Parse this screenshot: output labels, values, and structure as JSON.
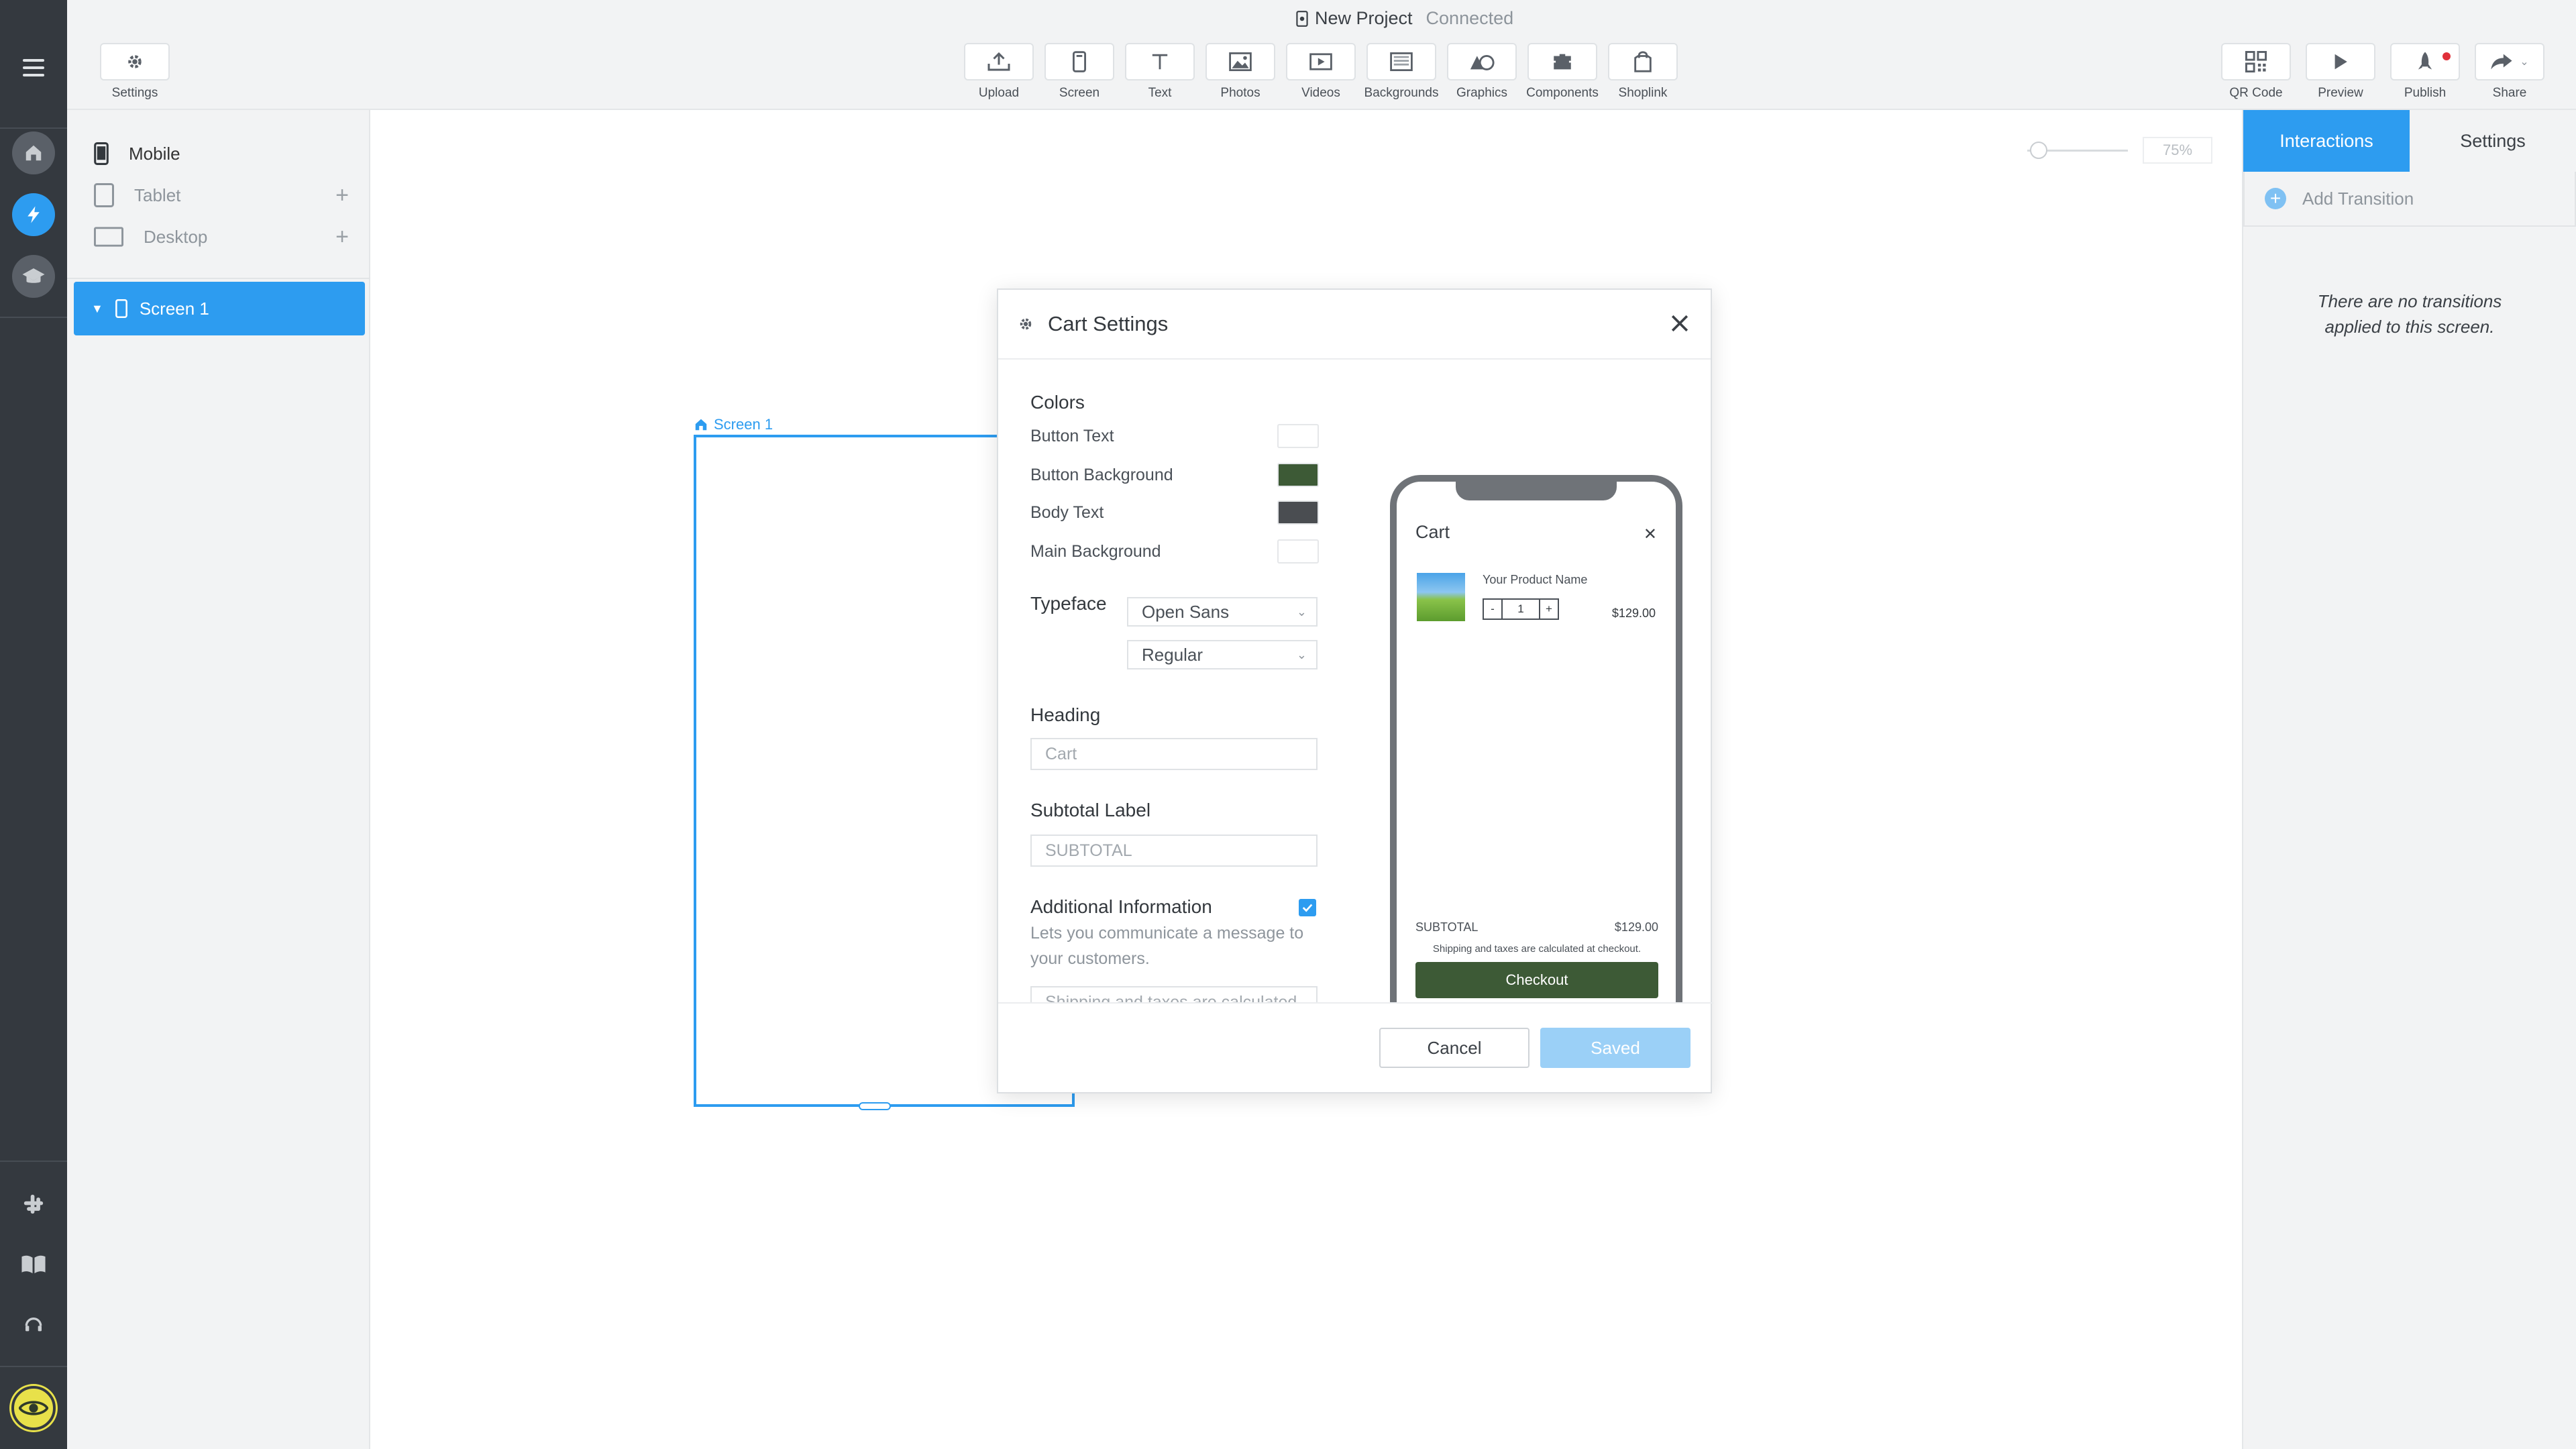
{
  "project": {
    "name": "New Project",
    "status": "Connected"
  },
  "toolbar": {
    "settings_label": "Settings",
    "center_items": [
      {
        "label": "Upload",
        "icon": "upload-icon"
      },
      {
        "label": "Screen",
        "icon": "screen-icon"
      },
      {
        "label": "Text",
        "icon": "text-icon"
      },
      {
        "label": "Photos",
        "icon": "photos-icon"
      },
      {
        "label": "Videos",
        "icon": "videos-icon"
      },
      {
        "label": "Backgrounds",
        "icon": "backgrounds-icon"
      },
      {
        "label": "Graphics",
        "icon": "graphics-icon"
      },
      {
        "label": "Components",
        "icon": "components-icon"
      },
      {
        "label": "Shoplink",
        "icon": "shoplink-icon"
      }
    ],
    "right_items": [
      {
        "label": "QR Code",
        "icon": "qr-code-icon"
      },
      {
        "label": "Preview",
        "icon": "play-icon"
      },
      {
        "label": "Publish",
        "icon": "rocket-icon"
      },
      {
        "label": "Share",
        "icon": "share-icon"
      }
    ]
  },
  "devices": [
    {
      "label": "Mobile",
      "active": true
    },
    {
      "label": "Tablet",
      "active": false
    },
    {
      "label": "Desktop",
      "active": false
    }
  ],
  "screens": [
    {
      "label": "Screen 1"
    }
  ],
  "canvas": {
    "zoom": "75%",
    "screen_label": "Screen 1"
  },
  "right_panel": {
    "tabs": [
      "Interactions",
      "Settings"
    ],
    "add_transition": "Add Transition",
    "empty_message": "There are no transitions applied to this screen."
  },
  "modal": {
    "title": "Cart Settings",
    "colors_heading": "Colors",
    "colors": [
      {
        "label": "Button Text",
        "value": "#ffffff"
      },
      {
        "label": "Button Background",
        "value": "#3d5a36"
      },
      {
        "label": "Body Text",
        "value": "#4a4d51"
      },
      {
        "label": "Main Background",
        "value": "#ffffff"
      }
    ],
    "typeface_label": "Typeface",
    "typeface": "Open Sans",
    "weight": "Regular",
    "heading_label": "Heading",
    "heading_placeholder": "Cart",
    "subtotal_label_heading": "Subtotal Label",
    "subtotal_placeholder": "SUBTOTAL",
    "additional_info_heading": "Additional Information",
    "additional_info_checked": true,
    "additional_info_help": "Lets you communicate a message to your customers.",
    "additional_info_placeholder": "Shipping and taxes are calculated",
    "cancel_label": "Cancel",
    "saved_label": "Saved"
  },
  "cart_preview": {
    "title": "Cart",
    "product_name": "Your Product Name",
    "qty_minus": "-",
    "qty": "1",
    "qty_plus": "+",
    "price": "$129.00",
    "subtotal_label": "SUBTOTAL",
    "subtotal_value": "$129.00",
    "shipping_note": "Shipping and taxes are calculated at checkout.",
    "checkout_label": "Checkout"
  }
}
